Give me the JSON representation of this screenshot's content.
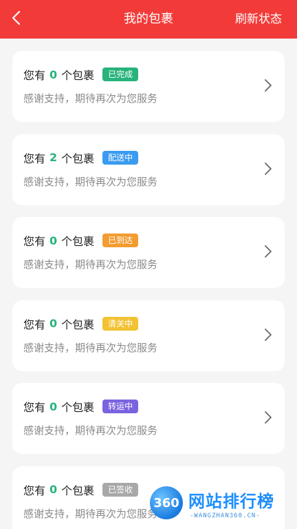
{
  "header": {
    "title": "我的包裹",
    "refresh_label": "刷新状态",
    "back_icon": "chevron-left-icon",
    "bg_color": "#f23b39"
  },
  "cards": [
    {
      "prefix": "您有",
      "count": "0",
      "suffix": "个包裹",
      "status": "已完成",
      "status_color": "#27b37a",
      "subtitle": "感谢支持，期待再次为您服务"
    },
    {
      "prefix": "您有",
      "count": "2",
      "suffix": "个包裹",
      "status": "配送中",
      "status_color": "#3a9bf0",
      "subtitle": "感谢支持，期待再次为您服务"
    },
    {
      "prefix": "您有",
      "count": "0",
      "suffix": "个包裹",
      "status": "已到达",
      "status_color": "#f39c32",
      "subtitle": "感谢支持，期待再次为您服务"
    },
    {
      "prefix": "您有",
      "count": "0",
      "suffix": "个包裹",
      "status": "清关中",
      "status_color": "#f2c233",
      "subtitle": "感谢支持，期待再次为您服务"
    },
    {
      "prefix": "您有",
      "count": "0",
      "suffix": "个包裹",
      "status": "转运中",
      "status_color": "#7b63e0",
      "subtitle": "感谢支持，期待再次为您服务"
    },
    {
      "prefix": "您有",
      "count": "0",
      "suffix": "个包裹",
      "status": "已签收",
      "status_color": "#a8a8a8",
      "subtitle": "感谢支持，期待再次为您服务"
    }
  ],
  "watermark": {
    "logo": "360",
    "text": "网站排行榜",
    "sub": "-WANGZHAN360.CN-"
  }
}
